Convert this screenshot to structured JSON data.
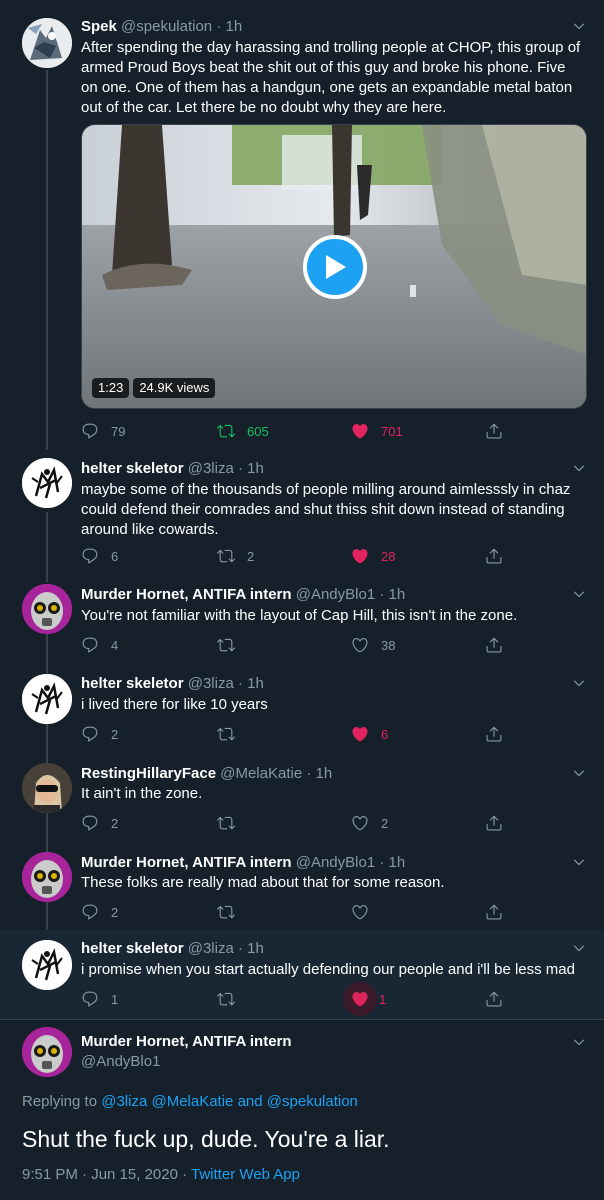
{
  "colors": {
    "background": "#15202b",
    "accent": "#1da1f2",
    "like": "#e0245e",
    "retweet": "#17bf63",
    "muted": "#8899a6"
  },
  "tweets": [
    {
      "name": "Spek",
      "handle": "@spekulation",
      "dot": "·",
      "time": "1h",
      "text": "After spending the day harassing and trolling people at CHOP, this group of armed Proud Boys beat the shit out of this guy and broke his phone. Five on one. One of them has a handgun, one gets an expandable metal baton out of the car. Let there be no doubt why they are here.",
      "video": {
        "duration": "1:23",
        "views": "24.9K views"
      },
      "replies": "79",
      "retweets": "605",
      "likes": "701",
      "avatar_icon": "spek-avatar-icon"
    },
    {
      "name": "helter skeletor",
      "handle": "@3liza",
      "dot": "·",
      "time": "1h",
      "text": "maybe some of the thousands of people milling around aimlesssly in chaz could defend their comrades and shut thiss shit down instead of standing around like cowards.",
      "replies": "6",
      "retweets": "2",
      "likes": "28"
    },
    {
      "name": "Murder Hornet, ANTIFA intern",
      "handle": "@AndyBlo1",
      "dot": "·",
      "time": "1h",
      "text": "You're not familiar with the layout of Cap Hill, this isn't in the zone.",
      "replies": "4",
      "retweets": "",
      "likes": "38"
    },
    {
      "name": "helter skeletor",
      "handle": "@3liza",
      "dot": "·",
      "time": "1h",
      "text": "i lived there for like 10 years",
      "replies": "2",
      "retweets": "",
      "likes": "6"
    },
    {
      "name": "RestingHillaryFace",
      "handle": "@MelaKatie",
      "dot": "·",
      "time": "1h",
      "text": "It ain't in the zone.",
      "replies": "2",
      "retweets": "",
      "likes": "2"
    },
    {
      "name": "Murder Hornet, ANTIFA intern",
      "handle": "@AndyBlo1",
      "dot": "·",
      "time": "1h",
      "text": "These folks are really mad about that for some reason.",
      "replies": "2",
      "retweets": "",
      "likes": ""
    },
    {
      "name": "helter skeletor",
      "handle": "@3liza",
      "dot": "·",
      "time": "1h",
      "text": "i promise when you start actually defending our people and i'll be less mad",
      "replies": "1",
      "retweets": "",
      "likes": "1"
    }
  ],
  "main": {
    "name": "Murder Hornet, ANTIFA intern",
    "handle": "@AndyBlo1",
    "replying_prefix": "Replying to",
    "replying_to": [
      "@3liza",
      "@MelaKatie"
    ],
    "replying_and": "and",
    "replying_last": "@spekulation",
    "text": "Shut the fuck up, dude. You're a liar.",
    "timestamp": "9:51 PM · Jun 15, 2020 ·",
    "app": "Twitter Web App"
  }
}
